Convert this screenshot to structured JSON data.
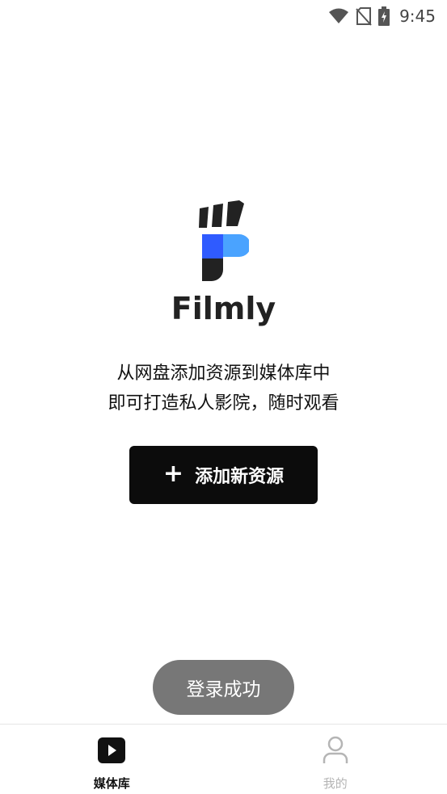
{
  "status_bar": {
    "time": "9:45",
    "icons": [
      "wifi-icon",
      "no-sim-icon",
      "battery-charging-icon"
    ]
  },
  "brand": {
    "name": "Filmly",
    "colors": {
      "dark": "#222222",
      "blue": "#2f6bff",
      "light_blue": "#4aa3ff"
    }
  },
  "empty_state": {
    "line1": "从网盘添加资源到媒体库中",
    "line2": "即可打造私人影院，随时观看"
  },
  "add_button": {
    "icon": "+",
    "label": "添加新资源"
  },
  "toast": {
    "message": "登录成功"
  },
  "bottom_nav": {
    "items": [
      {
        "label": "媒体库",
        "icon": "play-icon",
        "active": true
      },
      {
        "label": "我的",
        "icon": "user-icon",
        "active": false
      }
    ]
  }
}
